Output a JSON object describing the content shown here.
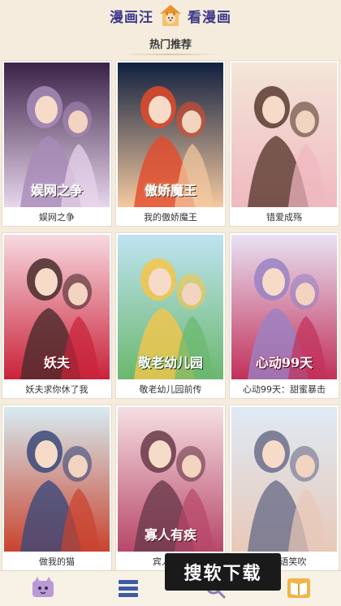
{
  "header": {
    "brand_left": "漫画汪",
    "brand_right": "看漫画",
    "logo_icon": "dog-house-logo-icon"
  },
  "section": {
    "title": "热门推荐"
  },
  "comics": [
    {
      "title": "娱网之争",
      "cover_text": "娱网之争",
      "palette": [
        "#3b2248",
        "#a78bb8",
        "#e8d6ec"
      ]
    },
    {
      "title": "我的傲娇魔王",
      "cover_text": "傲娇魔王",
      "palette": [
        "#10203f",
        "#e34a2a",
        "#f5c9a0"
      ]
    },
    {
      "title": "错爱成殇",
      "cover_text": "",
      "palette": [
        "#f3e6d8",
        "#5a3a2f",
        "#f0b8c0"
      ]
    },
    {
      "title": "妖夫求你休了我",
      "cover_text": "妖夫",
      "palette": [
        "#f7d9e0",
        "#4a2b2b",
        "#c9223a"
      ]
    },
    {
      "title": "敬老幼儿园前传",
      "cover_text": "敬老幼儿园",
      "palette": [
        "#bfe3f2",
        "#f5c64a",
        "#6bb86e"
      ]
    },
    {
      "title": "心动99天：甜蜜暴击",
      "cover_text": "心动99天",
      "palette": [
        "#e8e2f4",
        "#9a82c4",
        "#c2315a"
      ]
    },
    {
      "title": "做我的猫",
      "cover_text": "",
      "palette": [
        "#d7ecf2",
        "#3b4a7a",
        "#c9432e"
      ]
    },
    {
      "title": "宾人有疾",
      "cover_text": "寡人有疾",
      "palette": [
        "#f5dfe2",
        "#6a3a4a",
        "#b8476a"
      ]
    },
    {
      "title": "霍爷语笑吹",
      "cover_text": "",
      "palette": [
        "#dfeaf5",
        "#6b6e8a",
        "#e8c8b8"
      ]
    }
  ],
  "nav": {
    "items": [
      {
        "name": "home",
        "icon": "cat-face-icon"
      },
      {
        "name": "category",
        "icon": "list-icon"
      },
      {
        "name": "search",
        "icon": "search-icon"
      },
      {
        "name": "bookshelf",
        "icon": "book-icon"
      }
    ]
  },
  "watermark": {
    "text": "搜软下载"
  }
}
